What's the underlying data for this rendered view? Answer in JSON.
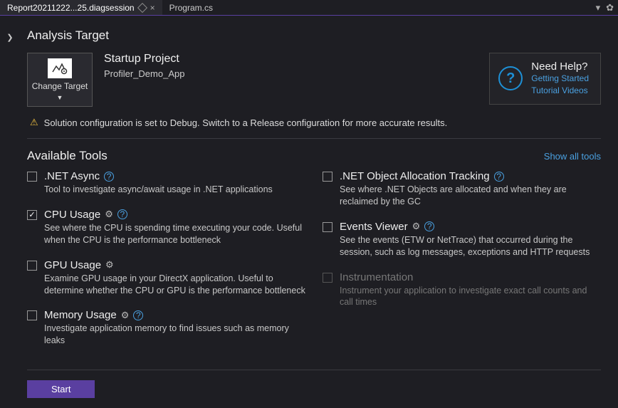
{
  "tabs": {
    "active": "Report20211222...25.diagsession",
    "inactive": "Program.cs"
  },
  "analysis": {
    "heading": "Analysis Target",
    "changeTarget": "Change Target",
    "projectTitle": "Startup Project",
    "projectName": "Profiler_Demo_App"
  },
  "help": {
    "title": "Need Help?",
    "link1": "Getting Started",
    "link2": "Tutorial Videos"
  },
  "warning": "Solution configuration is set to Debug. Switch to a Release configuration for more accurate results.",
  "toolsHeading": "Available Tools",
  "showAll": "Show all tools",
  "tools": {
    "netAsync": {
      "title": ".NET Async",
      "desc": "Tool to investigate async/await usage in .NET applications"
    },
    "cpu": {
      "title": "CPU Usage",
      "desc": "See where the CPU is spending time executing your code. Useful when the CPU is the performance bottleneck"
    },
    "gpu": {
      "title": "GPU Usage",
      "desc": "Examine GPU usage in your DirectX application. Useful to determine whether the CPU or GPU is the performance bottleneck"
    },
    "memory": {
      "title": "Memory Usage",
      "desc": "Investigate application memory to find issues such as memory leaks"
    },
    "alloc": {
      "title": ".NET Object Allocation Tracking",
      "desc": "See where .NET Objects are allocated and when they are reclaimed by the GC"
    },
    "events": {
      "title": "Events Viewer",
      "desc": "See the events (ETW or NetTrace) that occurred during the session, such as log messages, exceptions and HTTP requests"
    },
    "instr": {
      "title": "Instrumentation",
      "desc": "Instrument your application to investigate exact call counts and call times"
    }
  },
  "start": "Start"
}
